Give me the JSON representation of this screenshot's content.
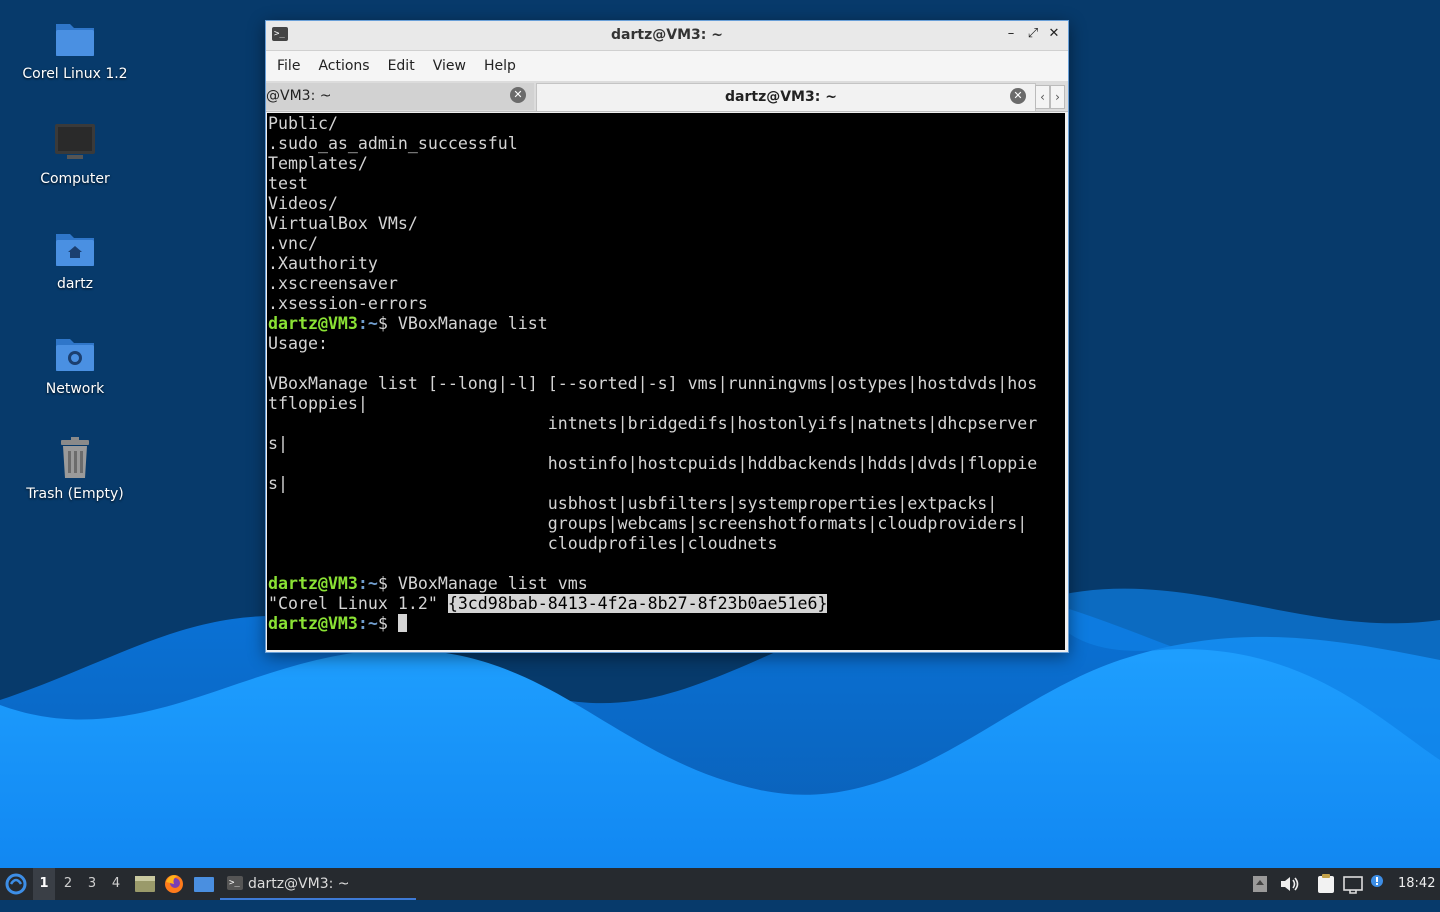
{
  "desktop": {
    "icons": [
      {
        "label": "Corel Linux 1.2",
        "icon": "folder-icon"
      },
      {
        "label": "Computer",
        "icon": "computer-icon"
      },
      {
        "label": "dartz",
        "icon": "home-folder-icon"
      },
      {
        "label": "Network",
        "icon": "network-folder-icon"
      },
      {
        "label": "Trash (Empty)",
        "icon": "trash-icon"
      }
    ]
  },
  "terminal": {
    "title": "dartz@VM3: ~",
    "controls": {
      "minimize": "–",
      "maximize": "⤢",
      "close": "✕"
    },
    "menu": [
      "File",
      "Actions",
      "Edit",
      "View",
      "Help"
    ],
    "tabs": [
      {
        "label": "@VM3: ~",
        "active": false
      },
      {
        "label": "dartz@VM3: ~",
        "active": true
      }
    ],
    "scroll_left": "‹",
    "scroll_right": "›",
    "prompt_user": "dartz@VM3",
    "prompt_path": ":~",
    "prompt_sigil": "$ ",
    "lines": [
      "Public/",
      ".sudo_as_admin_successful",
      "Templates/",
      "test",
      "Videos/",
      "VirtualBox VMs/",
      ".vnc/",
      ".Xauthority",
      ".xscreensaver",
      ".xsession-errors"
    ],
    "cmd1": "VBoxManage list",
    "usage_lines": [
      "Usage:",
      "",
      "VBoxManage list [--long|-l] [--sorted|-s] vms|runningvms|ostypes|hostdvds|hos",
      "tfloppies|",
      "                            intnets|bridgedifs|hostonlyifs|natnets|dhcpserver",
      "s|",
      "                            hostinfo|hostcpuids|hddbackends|hdds|dvds|floppie",
      "s|",
      "                            usbhost|usbfilters|systemproperties|extpacks|",
      "                            groups|webcams|screenshotformats|cloudproviders|",
      "                            cloudprofiles|cloudnets",
      ""
    ],
    "cmd2": "VBoxManage list vms",
    "vm_name": "\"Corel Linux 1.2\" ",
    "vm_uuid": "{3cd98bab-8413-4f2a-8b27-8f23b0ae51e6}"
  },
  "taskbar": {
    "workspaces": [
      "1",
      "2",
      "3",
      "4"
    ],
    "active_workspace": "1",
    "launchers": [
      "file-manager-icon",
      "firefox-icon",
      "show-desktop-icon"
    ],
    "window_button": "dartz@VM3: ~",
    "tray": [
      "notification-icon",
      "volume-icon",
      "clipboard-icon",
      "network-icon",
      "update-icon"
    ],
    "clock": "18:42"
  },
  "colors": {
    "prompt_user": "#8ae234",
    "prompt_path": "#729fcf",
    "taskbar_bg": "#262a2f",
    "wallpaper_dark": "#073a6b",
    "wallpaper_light": "#1e90ff"
  }
}
